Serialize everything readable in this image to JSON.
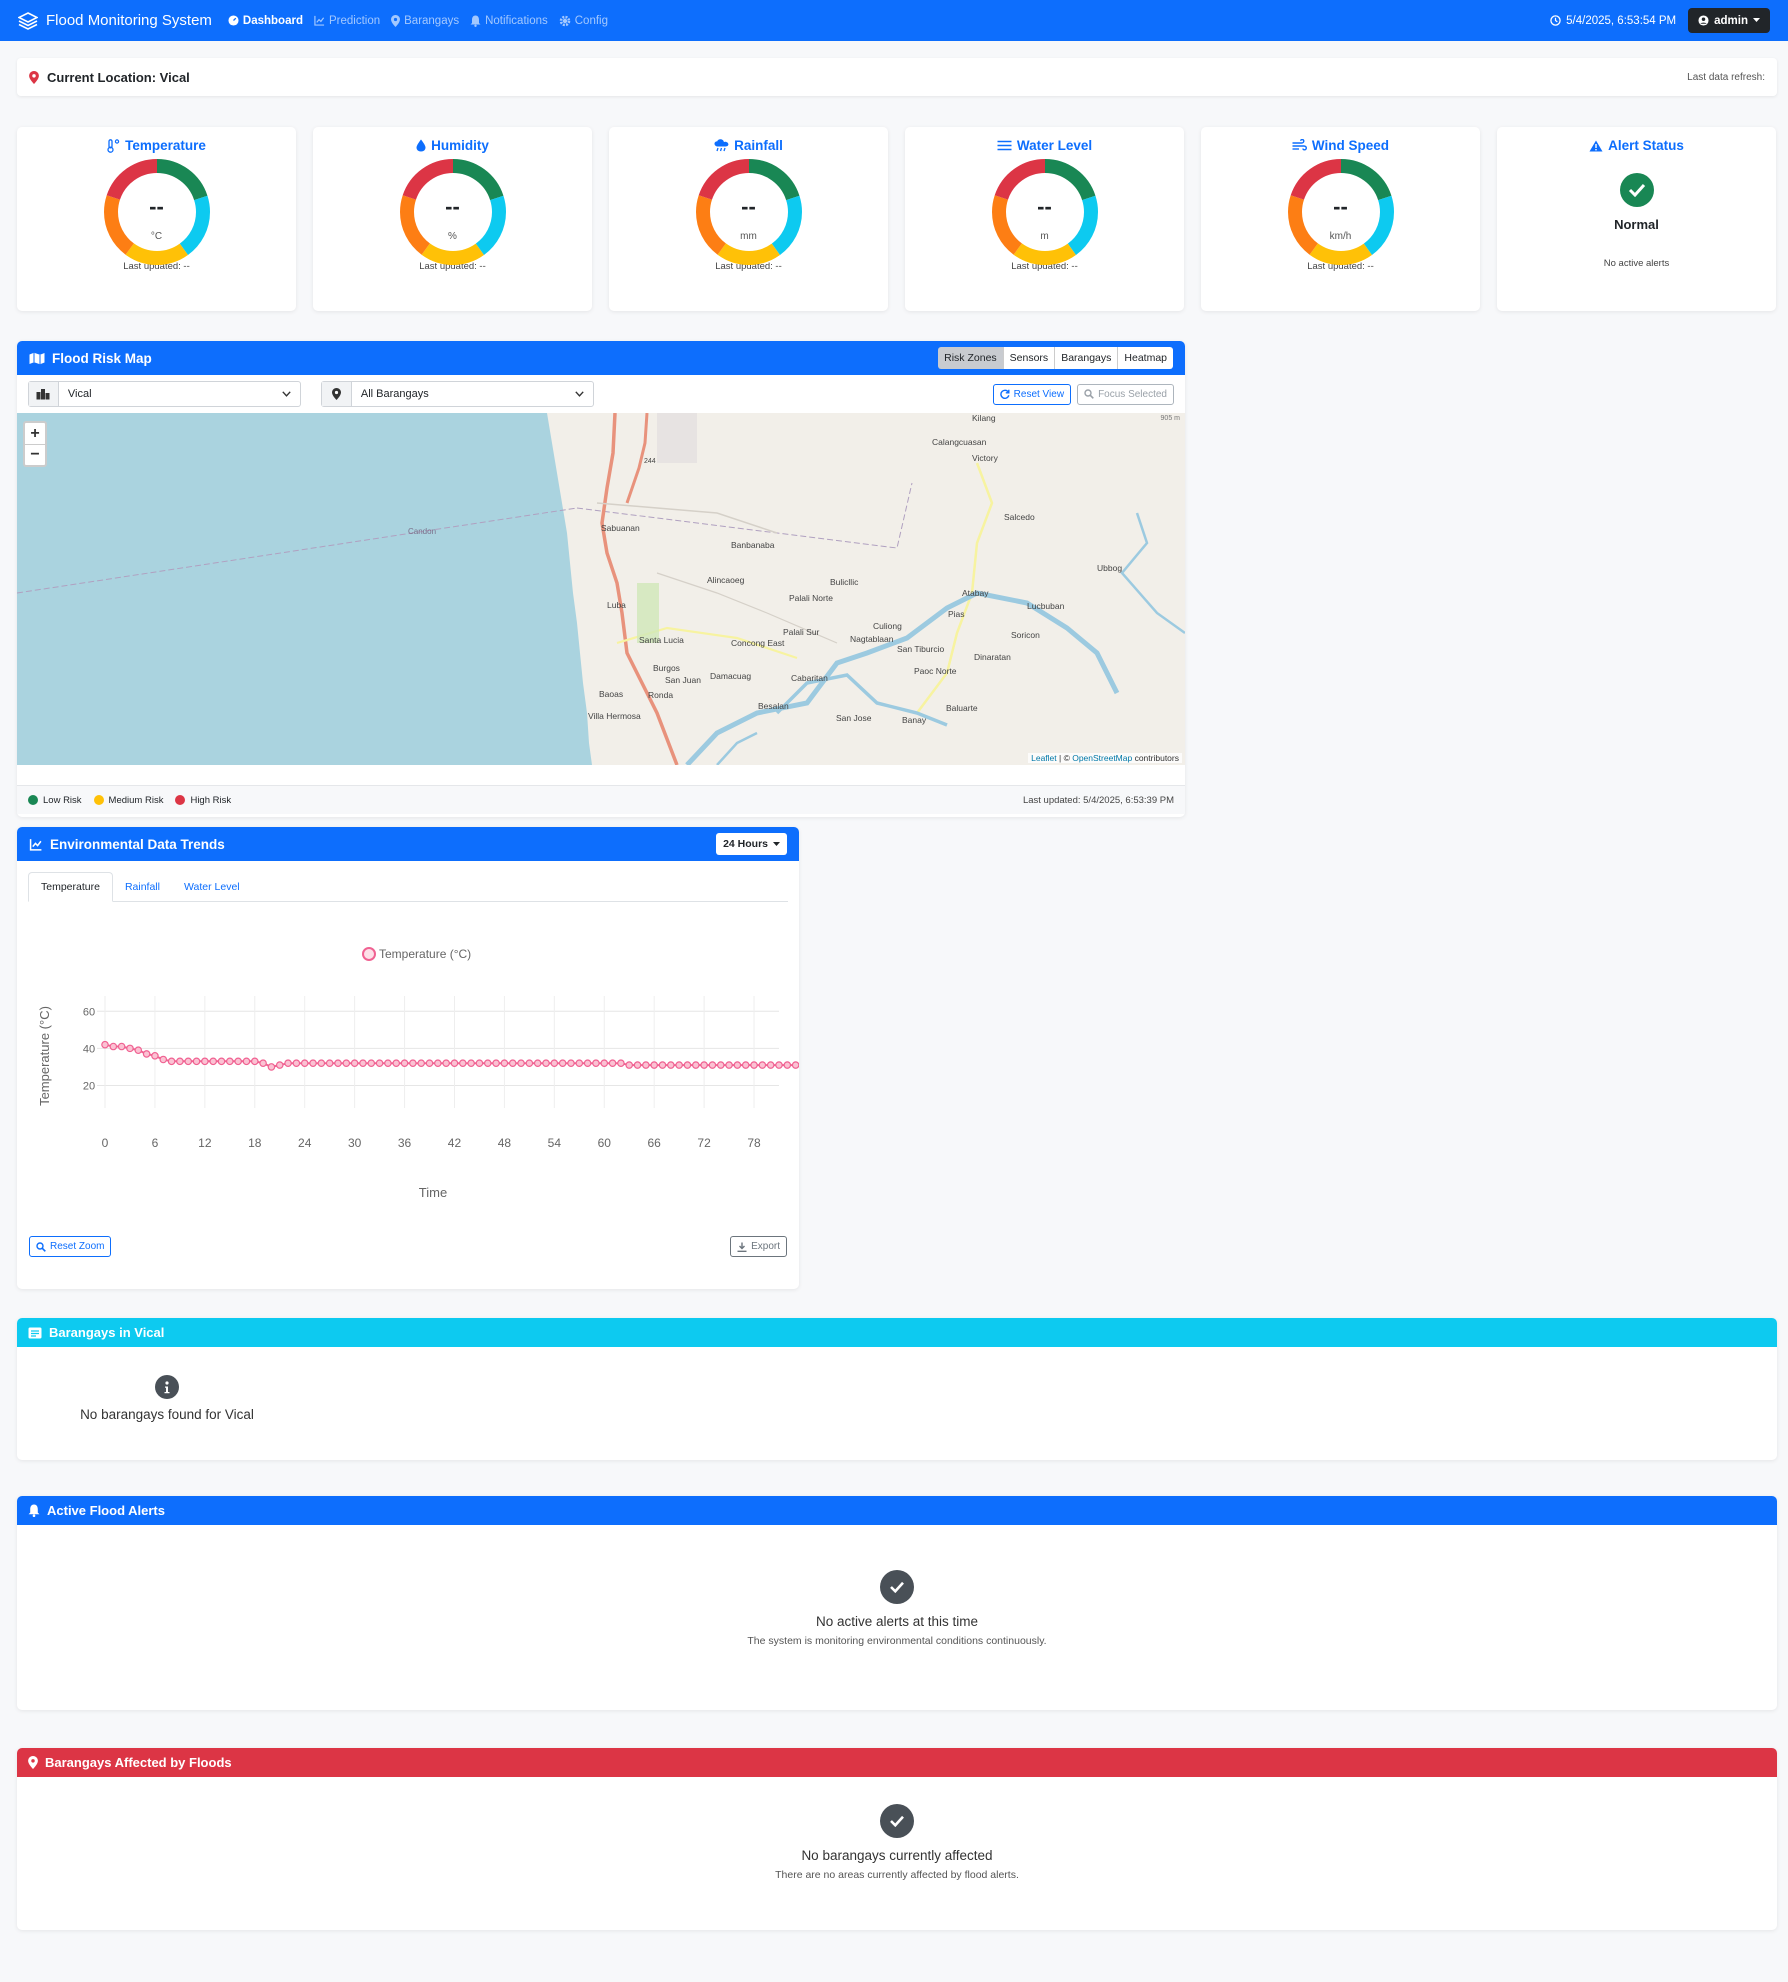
{
  "navbar": {
    "brand": "Flood Monitoring System",
    "items": [
      {
        "label": "Dashboard",
        "icon": "dashboard-icon",
        "active": true
      },
      {
        "label": "Prediction",
        "icon": "chart-line-icon",
        "active": false
      },
      {
        "label": "Barangays",
        "icon": "map-marker-icon",
        "active": false
      },
      {
        "label": "Notifications",
        "icon": "bell-icon",
        "active": false
      },
      {
        "label": "Config",
        "icon": "gear-icon",
        "active": false
      }
    ],
    "datetime": "5/4/2025, 6:53:54 PM",
    "user": "admin"
  },
  "location": {
    "title": "Current Location: Vical",
    "refresh_label": "Last data refresh:"
  },
  "metrics": [
    {
      "title": "Temperature",
      "icon": "thermometer-icon",
      "value": "--",
      "unit": "°C",
      "updated": "Last updated: --"
    },
    {
      "title": "Humidity",
      "icon": "droplet-icon",
      "value": "--",
      "unit": "%",
      "updated": "Last updated: --"
    },
    {
      "title": "Rainfall",
      "icon": "cloud-rain-icon",
      "value": "--",
      "unit": "mm",
      "updated": "Last updated: --"
    },
    {
      "title": "Water Level",
      "icon": "water-icon",
      "value": "--",
      "unit": "m",
      "updated": "Last updated: --"
    },
    {
      "title": "Wind Speed",
      "icon": "wind-icon",
      "value": "--",
      "unit": "km/h",
      "updated": "Last updated: --"
    }
  ],
  "alert_card": {
    "title": "Alert Status",
    "status": "Normal",
    "sub": "No active alerts"
  },
  "map": {
    "title": "Flood Risk Map",
    "layers": [
      "Risk Zones",
      "Sensors",
      "Barangays",
      "Heatmap"
    ],
    "active_layer": "Risk Zones",
    "municipality_select": "Vical",
    "barangay_select": "All Barangays",
    "reset_label": "Reset View",
    "focus_label": "Focus Selected",
    "scale_label": "905 m",
    "places": [
      "Kilang",
      "Calangcuasan",
      "Victory",
      "Salcedo",
      "Sabuanan",
      "Banbanaba",
      "Alincaoeg",
      "Bulicllic",
      "Palali Norte",
      "Ubbog",
      "Atabay",
      "Lucbuban",
      "Pias",
      "Luba",
      "Santa Lucia",
      "Palali Sur",
      "Culiong",
      "Nagtablaan",
      "Concong East",
      "San Tiburcio",
      "Soricon",
      "Dinaratan",
      "Burgos",
      "San Juan",
      "Damacuag",
      "Cabaritan",
      "Paoc Norte",
      "Baoas",
      "Ronda",
      "Villa Hermosa",
      "Besalan",
      "San Jose",
      "Banay",
      "Baluarte",
      "244"
    ],
    "attribution_leaflet": "Leaflet",
    "attribution_sep": " | © ",
    "attribution_osm": "OpenStreetMap",
    "attribution_tail": " contributors",
    "legend": [
      {
        "label": "Low Risk",
        "color": "#198754"
      },
      {
        "label": "Medium Risk",
        "color": "#ffc107"
      },
      {
        "label": "High Risk",
        "color": "#dc3545"
      }
    ],
    "updated": "Last updated: 5/4/2025, 6:53:39 PM"
  },
  "trends": {
    "title": "Environmental Data Trends",
    "range": "24 Hours",
    "tabs": [
      "Temperature",
      "Rainfall",
      "Water Level"
    ],
    "active_tab": "Temperature",
    "reset_zoom": "Reset Zoom",
    "export": "Export"
  },
  "chart_data": {
    "type": "line",
    "title": "",
    "xlabel": "Time",
    "ylabel": "Temperature (°C)",
    "series": [
      {
        "name": "Temperature (°C)",
        "color": "#f06292",
        "values": [
          42,
          41,
          41,
          40,
          39,
          37,
          36,
          34,
          33,
          33,
          33,
          33,
          33,
          33,
          33,
          33,
          33,
          33,
          33,
          32,
          30,
          31,
          32,
          32,
          32,
          32,
          32,
          32,
          32,
          32,
          32,
          32,
          32,
          32,
          32,
          32,
          32,
          32,
          32,
          32,
          32,
          32,
          32,
          32,
          32,
          32,
          32,
          32,
          32,
          32,
          32,
          32,
          32,
          32,
          32,
          32,
          32,
          32,
          32,
          32,
          32,
          32,
          32,
          31,
          31,
          31,
          31,
          31,
          31,
          31,
          31,
          31,
          31,
          31,
          31,
          31,
          31,
          31,
          31,
          31,
          31,
          31,
          31,
          31,
          31,
          30
        ]
      }
    ],
    "x_start": 0,
    "x_ticks": [
      "0",
      "6",
      "12",
      "18",
      "24",
      "30",
      "36",
      "42",
      "48",
      "54",
      "60",
      "66",
      "72",
      "78"
    ],
    "y_ticks": [
      "60",
      "40",
      "20"
    ],
    "ylim": [
      10,
      65
    ],
    "grid": true,
    "legend": "top-center"
  },
  "barangays_card": {
    "title": "Barangays in Vical",
    "empty": "No barangays found for Vical",
    "color": "#0dcaf0"
  },
  "alerts_card": {
    "title": "Active Flood Alerts",
    "empty_title": "No active alerts at this time",
    "empty_sub": "The system is monitoring environmental conditions continuously.",
    "color": "#0d6efd"
  },
  "affected_card": {
    "title": "Barangays Affected by Floods",
    "empty_title": "No barangays currently affected",
    "empty_sub": "There are no areas currently affected by flood alerts.",
    "color": "#dc3545"
  }
}
